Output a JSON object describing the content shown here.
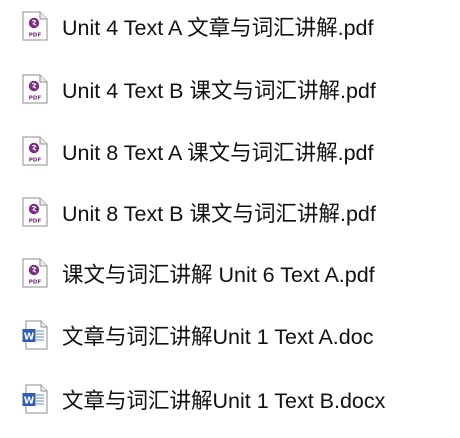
{
  "files": [
    {
      "name": "Unit 4 Text A 文章与词汇讲解.pdf",
      "type": "pdf",
      "icon": "pdf-file-icon",
      "icon_label": "PDF"
    },
    {
      "name": "Unit 4 Text B 课文与词汇讲解.pdf",
      "type": "pdf",
      "icon": "pdf-file-icon",
      "icon_label": "PDF"
    },
    {
      "name": "Unit 8 Text A 课文与词汇讲解.pdf",
      "type": "pdf",
      "icon": "pdf-file-icon",
      "icon_label": "PDF"
    },
    {
      "name": "Unit 8 Text B 课文与词汇讲解.pdf",
      "type": "pdf",
      "icon": "pdf-file-icon",
      "icon_label": "PDF"
    },
    {
      "name": "课文与词汇讲解 Unit 6 Text A.pdf",
      "type": "pdf",
      "icon": "pdf-file-icon",
      "icon_label": "PDF"
    },
    {
      "name": "文章与词汇讲解Unit 1 Text A.doc",
      "type": "doc",
      "icon": "word-file-icon",
      "icon_label": "W"
    },
    {
      "name": "文章与词汇讲解Unit 1 Text B.docx",
      "type": "docx",
      "icon": "word-file-icon",
      "icon_label": "W"
    }
  ],
  "colors": {
    "pdf_accent": "#7b2d83",
    "word_accent": "#2b5fb4",
    "text": "#111111"
  }
}
